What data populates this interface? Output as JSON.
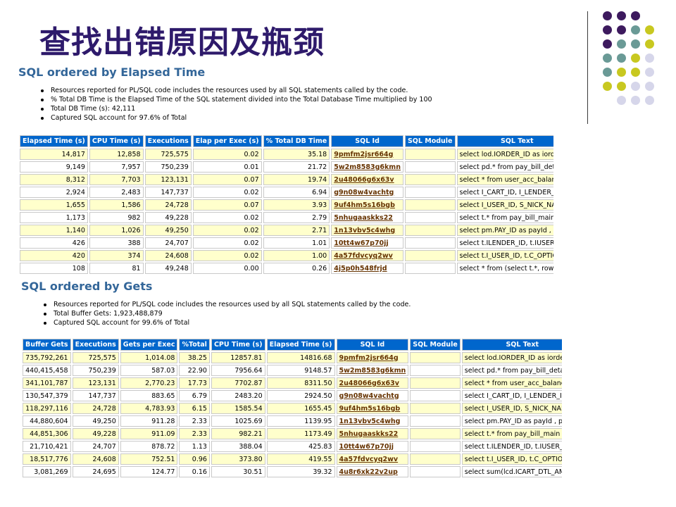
{
  "slide_title": "查找出错原因及瓶颈",
  "colors": {
    "title": "#2e1a6b",
    "report_title": "#336699",
    "header_bg": "#0066cc",
    "row_highlight": "#ffffcc",
    "sql_id_link": "#663300",
    "dot_purple": "#3d1a5e",
    "dot_teal": "#6a9a96",
    "dot_yellow": "#c8c820",
    "dot_lavender": "#d6d6ea"
  },
  "dot_colors": [
    [
      "dot_purple",
      "dot_purple",
      "dot_purple",
      "",
      ""
    ],
    [
      "dot_purple",
      "dot_purple",
      "dot_teal",
      "dot_yellow",
      ""
    ],
    [
      "dot_purple",
      "dot_teal",
      "dot_teal",
      "dot_yellow",
      ""
    ],
    [
      "dot_teal",
      "dot_teal",
      "dot_yellow",
      "dot_lavender",
      ""
    ],
    [
      "dot_teal",
      "dot_yellow",
      "dot_yellow",
      "dot_lavender",
      ""
    ],
    [
      "dot_yellow",
      "dot_yellow",
      "dot_lavender",
      "dot_lavender",
      ""
    ],
    [
      "",
      "dot_lavender",
      "dot_lavender",
      "dot_lavender",
      ""
    ]
  ],
  "report1": {
    "title": "SQL ordered by Elapsed Time",
    "bullets": [
      "Resources reported for PL/SQL code includes the resources used by all SQL statements called by the code.",
      "% Total DB Time is the Elapsed Time of the SQL statement divided into the Total Database Time multiplied by 100",
      "Total DB Time (s): 42,111",
      "Captured SQL account for 97.6% of Total"
    ],
    "headers": [
      "Elapsed Time (s)",
      "CPU Time (s)",
      "Executions",
      "Elap per Exec (s)",
      "% Total DB Time",
      "SQL Id",
      "SQL Module",
      "SQL Text"
    ],
    "rows": [
      [
        "14,817",
        "12,858",
        "725,575",
        "0.02",
        "35.18",
        "9pmfm2jsr664g",
        "",
        "select lod.IORDER_ID as iorder..."
      ],
      [
        "9,149",
        "7,957",
        "750,239",
        "0.01",
        "21.72",
        "5w2m8583g6kmn",
        "",
        "select pd.* from pay_bill_deta..."
      ],
      [
        "8,312",
        "7,703",
        "123,131",
        "0.07",
        "19.74",
        "2u48066g6x63v",
        "",
        "select * from user_acc_balance..."
      ],
      [
        "2,924",
        "2,483",
        "147,737",
        "0.02",
        "6.94",
        "g9n08w4vachtg",
        "",
        "select I_CART_ID, I_LENDER_ID,..."
      ],
      [
        "1,655",
        "1,586",
        "24,728",
        "0.07",
        "3.93",
        "9uf4hm5s16bgb",
        "",
        "select I_USER_ID, S_NICK_NAME,..."
      ],
      [
        "1,173",
        "982",
        "49,228",
        "0.02",
        "2.79",
        "5nhugaaskks22",
        "",
        "select t.* from pay_bill_main ..."
      ],
      [
        "1,140",
        "1,026",
        "49,250",
        "0.02",
        "2.71",
        "1n13vbv5c4whg",
        "",
        "select pm.PAY_ID as payId , pm..."
      ],
      [
        "426",
        "388",
        "24,707",
        "0.02",
        "1.01",
        "10tt4w67p70jj",
        "",
        "select t.ILENDER_ID, t.IUSER_I..."
      ],
      [
        "420",
        "374",
        "24,608",
        "0.02",
        "1.00",
        "4a57fdvcyq2wv",
        "",
        "select t.I_USER_ID, t.C_OPTION..."
      ],
      [
        "108",
        "81",
        "49,248",
        "0.00",
        "0.26",
        "4j5p0h548frjd",
        "",
        "select * from (select t.*, row..."
      ]
    ]
  },
  "report2": {
    "title": "SQL ordered by Gets",
    "bullets": [
      "Resources reported for PL/SQL code includes the resources used by all SQL statements called by the code.",
      "Total Buffer Gets: 1,923,488,879",
      "Captured SQL account for 99.6% of Total"
    ],
    "headers": [
      "Buffer Gets",
      "Executions",
      "Gets per Exec",
      "%Total",
      "CPU Time (s)",
      "Elapsed Time (s)",
      "SQL Id",
      "SQL Module",
      "SQL Text"
    ],
    "rows": [
      [
        "735,792,261",
        "725,575",
        "1,014.08",
        "38.25",
        "12857.81",
        "14816.68",
        "9pmfm2jsr664g",
        "",
        "select lod.IORDER_ID as iorder..."
      ],
      [
        "440,415,458",
        "750,239",
        "587.03",
        "22.90",
        "7956.64",
        "9148.57",
        "5w2m8583g6kmn",
        "",
        "select pd.* from pay_bill_deta..."
      ],
      [
        "341,101,787",
        "123,131",
        "2,770.23",
        "17.73",
        "7702.87",
        "8311.50",
        "2u48066g6x63v",
        "",
        "select * from user_acc_balance..."
      ],
      [
        "130,547,379",
        "147,737",
        "883.65",
        "6.79",
        "2483.20",
        "2924.50",
        "g9n08w4vachtg",
        "",
        "select I_CART_ID, I_LENDER_ID,..."
      ],
      [
        "118,297,116",
        "24,728",
        "4,783.93",
        "6.15",
        "1585.54",
        "1655.45",
        "9uf4hm5s16bgb",
        "",
        "select I_USER_ID, S_NICK_NAME,..."
      ],
      [
        "44,880,604",
        "49,250",
        "911.28",
        "2.33",
        "1025.69",
        "1139.95",
        "1n13vbv5c4whg",
        "",
        "select pm.PAY_ID as payId , pm..."
      ],
      [
        "44,851,306",
        "49,228",
        "911.09",
        "2.33",
        "982.21",
        "1173.49",
        "5nhugaaskks22",
        "",
        "select t.* from pay_bill_main ..."
      ],
      [
        "21,710,421",
        "24,707",
        "878.72",
        "1.13",
        "388.04",
        "425.83",
        "10tt4w67p70jj",
        "",
        "select t.ILENDER_ID, t.IUSER_I..."
      ],
      [
        "18,517,776",
        "24,608",
        "752.51",
        "0.96",
        "373.80",
        "419.55",
        "4a57fdvcyq2wv",
        "",
        "select t.I_USER_ID, t.C_OPTION..."
      ],
      [
        "3,081,269",
        "24,695",
        "124.77",
        "0.16",
        "30.51",
        "39.32",
        "4u8r6xk22v2up",
        "",
        "select sum(lcd.ICART_DTL_AMT) ..."
      ]
    ]
  }
}
